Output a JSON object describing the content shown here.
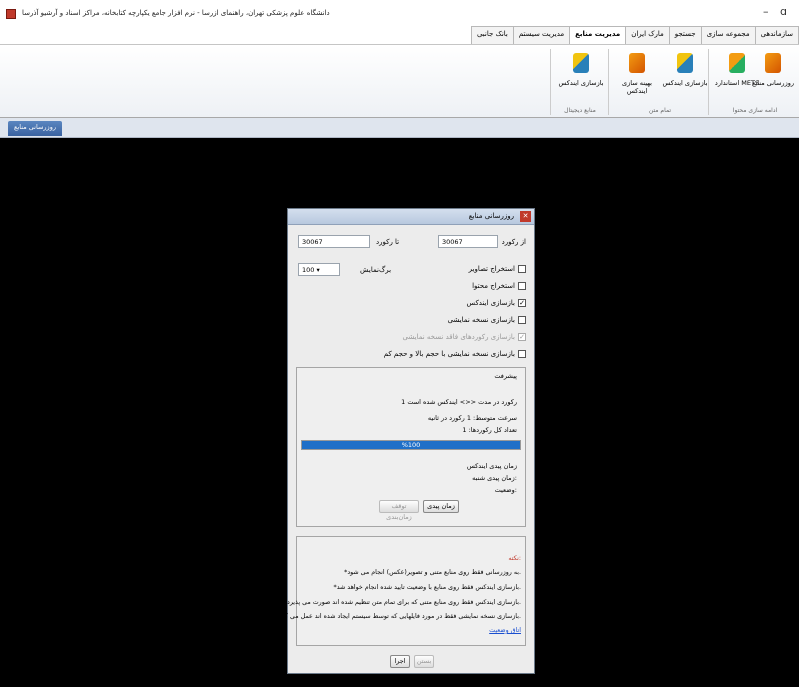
{
  "window": {
    "title": "دانشگاه علوم پزشکی تهران، راهنمای ازرسا - نرم افزار جامع یکپارچه کتابخانه، مراکز اسناد و آرشیو آذرسا",
    "minimize_glyph": "–",
    "maximize_glyph": "ɑ"
  },
  "ribbon": {
    "tabs": [
      "سازماندهی",
      "مجموعه سازی",
      "جستجو",
      "مارک ایران",
      "مدیریت منابع",
      "مدیریت سیستم",
      "بانک جانبی"
    ],
    "active_tab": "مدیریت منابع",
    "buttons": {
      "update_resources": "روزرسانی منابع",
      "mets_file": "استاندارد METS",
      "rebuild_index_1": "بازسازی ایندکس",
      "optimize_index": "بهینه سازی ایندکس",
      "rebuild_index_2": "بازسازی ایندکس"
    },
    "groups": {
      "content_tools": "ادامه سازی محتوا",
      "fulltext": "تمام متن",
      "digital_resources": "منابع دیجیتال"
    }
  },
  "doc_tab": {
    "label": "روزرسانی منابع"
  },
  "dialog": {
    "title": "روزرسانی منابع",
    "from_label": "از رکورد",
    "from_value": "30067",
    "to_label": "تا رکورد",
    "to_value": "30067",
    "options": {
      "extract_images": "استخراج تصاویر",
      "extract_content": "استخراج محتوا",
      "rebuild_index": "بازسازی ایندکس",
      "rebuild_display_copy": "بازسازی نسخه نمایشی",
      "rebuild_records_no_display": "بازسازی رکوردهای فاقد نسخه نمایشی",
      "rebuild_display_large": "بازسازی نسخه نمایشی با حجم بالا و حجم کم"
    },
    "page_size_label": "برگ‌نمایش",
    "page_size_value": "100",
    "progress": {
      "title": "پیشرفت",
      "line1": "1 رکورد در مدت <<> ایندکس شده است",
      "line2": "سرعت متوسط: 1 رکورد در ثانیه",
      "line3": "تعداد کل رکوردها: 1",
      "percent": 100,
      "bar_text": "%100",
      "start_time_label": "زمان پیدی ایندکس",
      "end_time_label": "زمان پیدی شنبه:",
      "status_label": "وضعیت:",
      "start_button": "زمان پیدی",
      "stop_button": "توقف زمان‌بندی"
    },
    "notes": {
      "title": "نکته:",
      "n1": "*به روزرسانی فقط روی منابع متنی و تصویر(عکس) انجام می شود.",
      "n2": "*بازسازی ایندکس فقط روی منابع با وضعیت تایید شده انجام خواهد شد.",
      "n3": "*بازسازی ایندکس فقط روی منابع متنی که برای تمام متن تنظیم شده اند صورت می پذیرد.",
      "n4": "*بازسازی نسخه نمایشی فقط در مورد فایلهایی که توسط سیستم ایجاد شده اند عمل می کند.",
      "link": "اتاق وضعیت"
    },
    "ok_button": "اجرا",
    "cancel_button": "بستن"
  }
}
